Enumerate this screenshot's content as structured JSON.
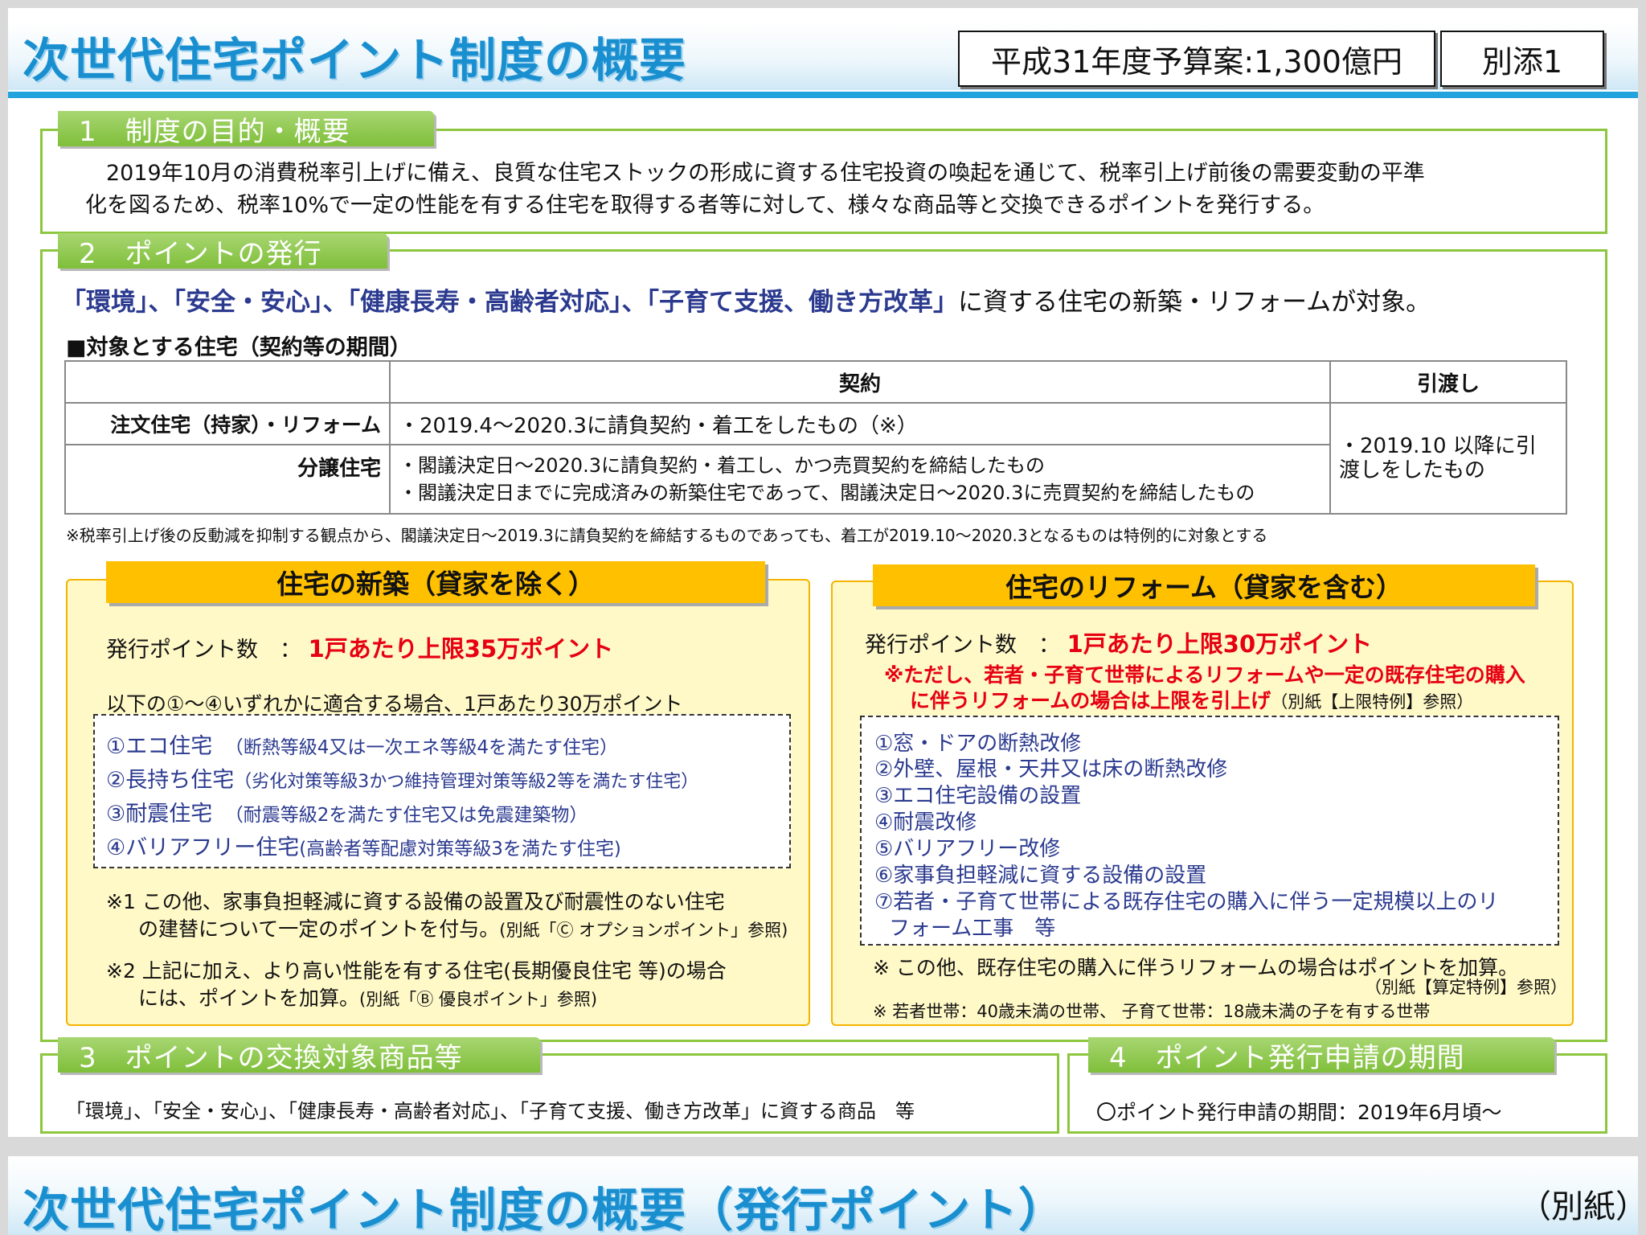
{
  "header": {
    "title": "次世代住宅ポイント制度の概要",
    "budget": "平成31年度予算案:1,300億円",
    "annex": "別添1"
  },
  "section1": {
    "tab": "1　制度の目的・概要",
    "line1": "2019年10月の消費税率引上げに備え、良質な住宅ストックの形成に資する住宅投資の喚起を通じて、税率引上げ前後の需要変動の平準",
    "line2": "化を図るため、税率10%で一定の性能を有する住宅を取得する者等に対して、様々な商品等と交換できるポイントを発行する。"
  },
  "section2": {
    "tab": "2　ポイントの発行",
    "highlight_bold": "「環境」、「安全・安心」、「健康長寿・高齢者対応」、「子育て支援、働き方改革」",
    "highlight_rest": "に資する住宅の新築・リフォームが対象。",
    "table_heading": "■対象とする住宅（契約等の期間）",
    "table": {
      "header_contract": "契約",
      "header_delivery": "引渡し",
      "row1_label": "注文住宅（持家）・リフォーム",
      "row1_contract": "・2019.4～2020.3に請負契約・着工をしたもの（※）",
      "row2_label": "分譲住宅",
      "row2_contract_1": "・閣議決定日～2020.3に請負契約・着工し、かつ売買契約を締結したもの",
      "row2_contract_2": "・閣議決定日までに完成済みの新築住宅であって、閣議決定日～2020.3に売買契約を締結したもの",
      "delivery_1": "・2019.10 以降に引",
      "delivery_2": "渡しをしたもの"
    },
    "table_note": "※税率引上げ後の反動減を抑制する観点から、閣議決定日～2019.3に請負契約を締結するものであっても、着工が2019.10～2020.3となるものは特例的に対象とする",
    "newbuild": {
      "title": "住宅の新築（貸家を除く）",
      "points_label": "発行ポイント数　：",
      "points_value": "1戸あたり上限35万ポイント",
      "condition": "以下の①～④いずれかに適合する場合、1戸あたり30万ポイント",
      "items": [
        {
          "name": "①エコ住宅",
          "desc": "（断熱等級4又は一次エネ等級4を満たす住宅）"
        },
        {
          "name": "②長持ち住宅",
          "desc": "（劣化対策等級3かつ維持管理対策等級2等を満たす住宅）"
        },
        {
          "name": "③耐震住宅",
          "desc": "（耐震等級2を満たす住宅又は免震建築物）"
        },
        {
          "name": "④バリアフリー住宅",
          "desc": "(高齢者等配慮対策等級3を満たす住宅)"
        }
      ],
      "note1_a": "※1 この他、家事負担軽減に資する設備の設置及び耐震性のない住宅",
      "note1_b": "の建替について一定のポイントを付与。",
      "note1_ref": "(別紙「Ⓒ オプションポイント」参照)",
      "note2_a": "※2 上記に加え、より高い性能を有する住宅(長期優良住宅 等)の場合",
      "note2_b": "には、ポイントを加算。",
      "note2_ref": "(別紙「Ⓑ 優良ポイント」参照)"
    },
    "reform": {
      "title": "住宅のリフォーム（貸家を含む）",
      "points_label": "発行ポイント数　：",
      "points_value": "1戸あたり上限30万ポイント",
      "special_1": "※ただし、若者・子育て世帯によるリフォームや一定の既存住宅の購入",
      "special_2": "に伴うリフォームの場合は上限を引上げ",
      "special_ref": "（別紙【上限特例】参照）",
      "items": [
        "①窓・ドアの断熱改修",
        "②外壁、屋根・天井又は床の断熱改修",
        "③エコ住宅設備の設置",
        "④耐震改修",
        "⑤バリアフリー改修",
        "⑥家事負担軽減に資する設備の設置",
        "⑦若者・子育て世帯による既存住宅の購入に伴う一定規模以上のリ",
        "フォーム工事　等"
      ],
      "note1": "※ この他、既存住宅の購入に伴うリフォームの場合はポイントを加算。",
      "note1_ref": "（別紙【算定特例】参照）",
      "note2": "※ 若者世帯：40歳未満の世帯、 子育て世帯：18歳未満の子を有する世帯"
    }
  },
  "section3": {
    "tab": "3　ポイントの交換対象商品等",
    "text": "「環境」、「安全・安心」、「健康長寿・高齢者対応」、「子育て支援、働き方改革」に資する商品　等"
  },
  "section4": {
    "tab": "4　ポイント発行申請の期間",
    "text": "〇ポイント発行申請の期間：2019年6月頃～"
  },
  "next_slide": {
    "title": "次世代住宅ポイント制度の概要（発行ポイント）",
    "label": "（別紙）"
  }
}
